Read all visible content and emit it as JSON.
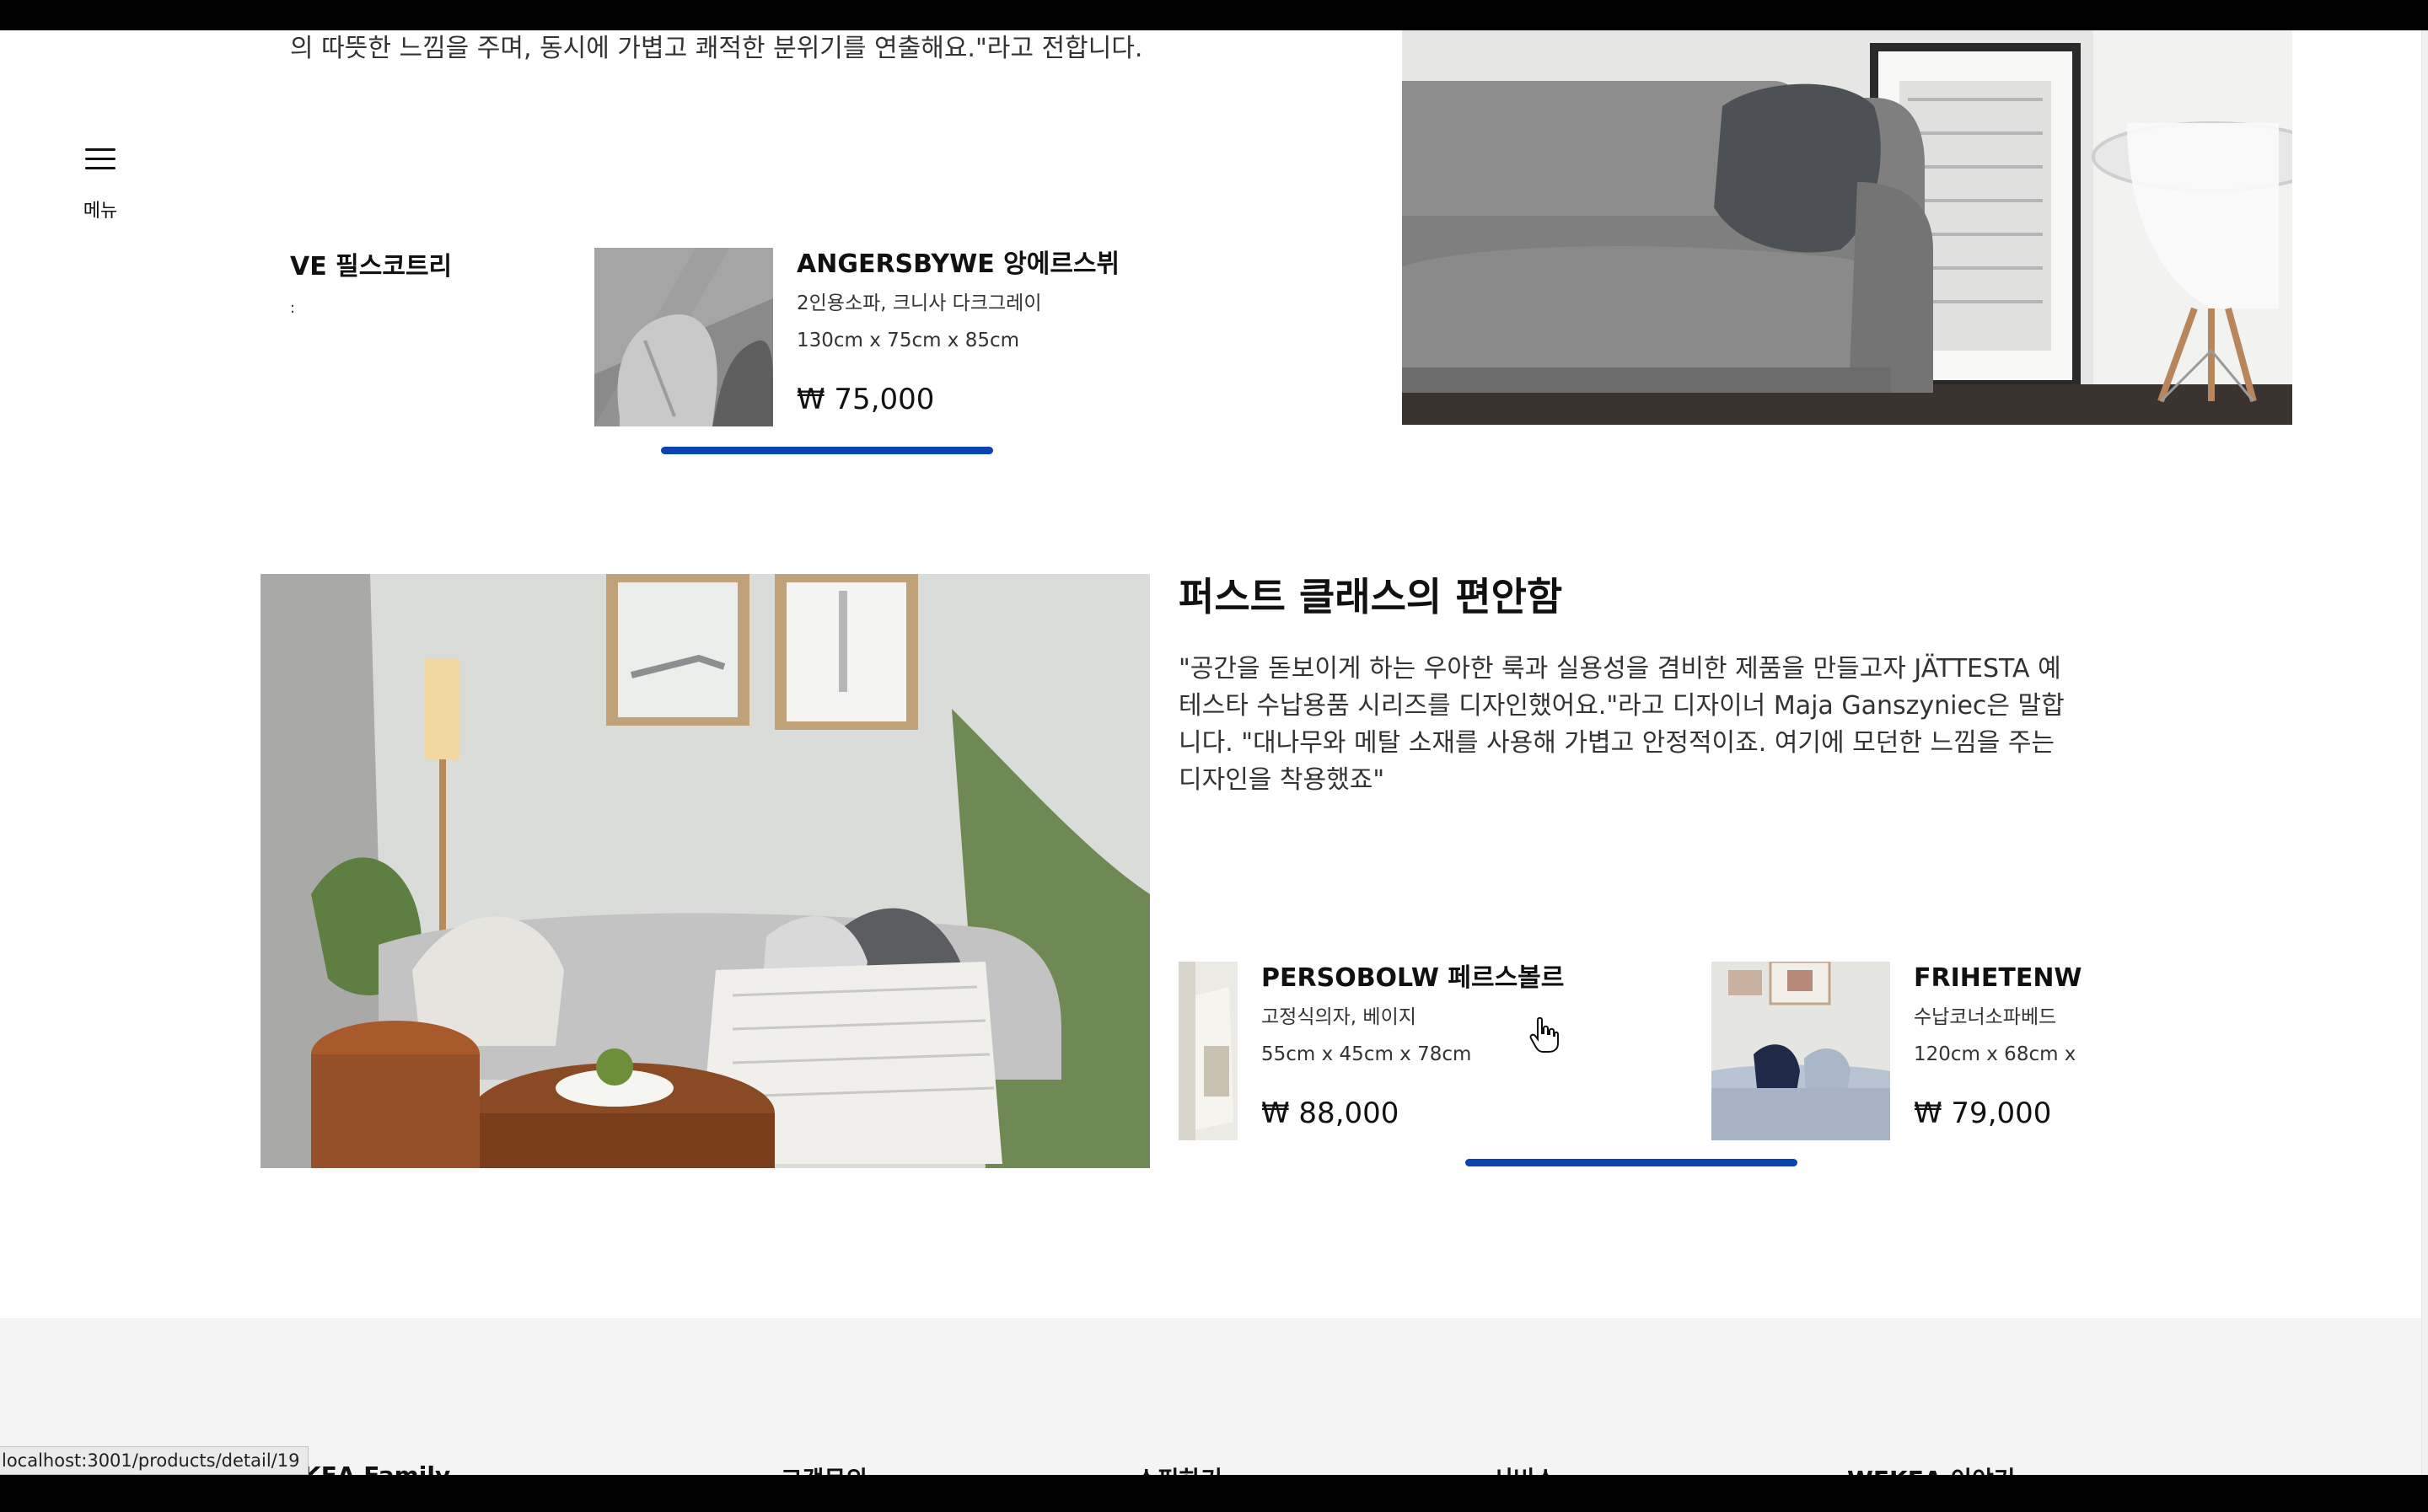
{
  "nav": {
    "menu_label": "메뉴"
  },
  "top_quote": "의 따뜻한 느낌을 주며, 동시에 가볍고 쾌적한 분위기를 연출해요.\"라고 전합니다.",
  "carousel1": {
    "partial_item": {
      "name": "VE 필스코트리",
      "sub": ":"
    },
    "item": {
      "name": "ANGERSBYWE 앙에르스뷔",
      "desc": "2인용소파, 크니사 다크그레이",
      "size": "130cm x 75cm x 85cm",
      "price": "₩ 75,000"
    }
  },
  "section": {
    "title": "퍼스트 클래스의 편안함",
    "body": "\"공간을 돋보이게 하는 우아한 룩과 실용성을 겸비한 제품을 만들고자 JÄTTESTA 예테스타 수납용품 시리즈를 디자인했어요.\"라고 디자이너 Maja Ganszyniec은 말합니다. \"대나무와 메탈 소재를 사용해 가볍고 안정적이죠. 여기에 모던한 느낌을 주는 디자인을 착용했죠\""
  },
  "carousel2": {
    "items": [
      {
        "name": "PERSOBOLW 페르스볼르",
        "desc": "고정식의자, 베이지",
        "size": "55cm x 45cm x 78cm",
        "price": "₩ 88,000"
      },
      {
        "name": "FRIHETENW",
        "desc": "수납코너소파베드",
        "size": "120cm x 68cm x",
        "price": "₩ 79,000"
      }
    ]
  },
  "footer": {
    "columns": [
      "WEKEA Family",
      "고객문의",
      "쇼핑하기",
      "서비스",
      "WEKEA 이야기"
    ]
  },
  "status_bar": {
    "url": "localhost:3001/products/detail/19"
  },
  "colors": {
    "accent": "#0a44b2",
    "footer_bg": "#f4f4f4"
  }
}
